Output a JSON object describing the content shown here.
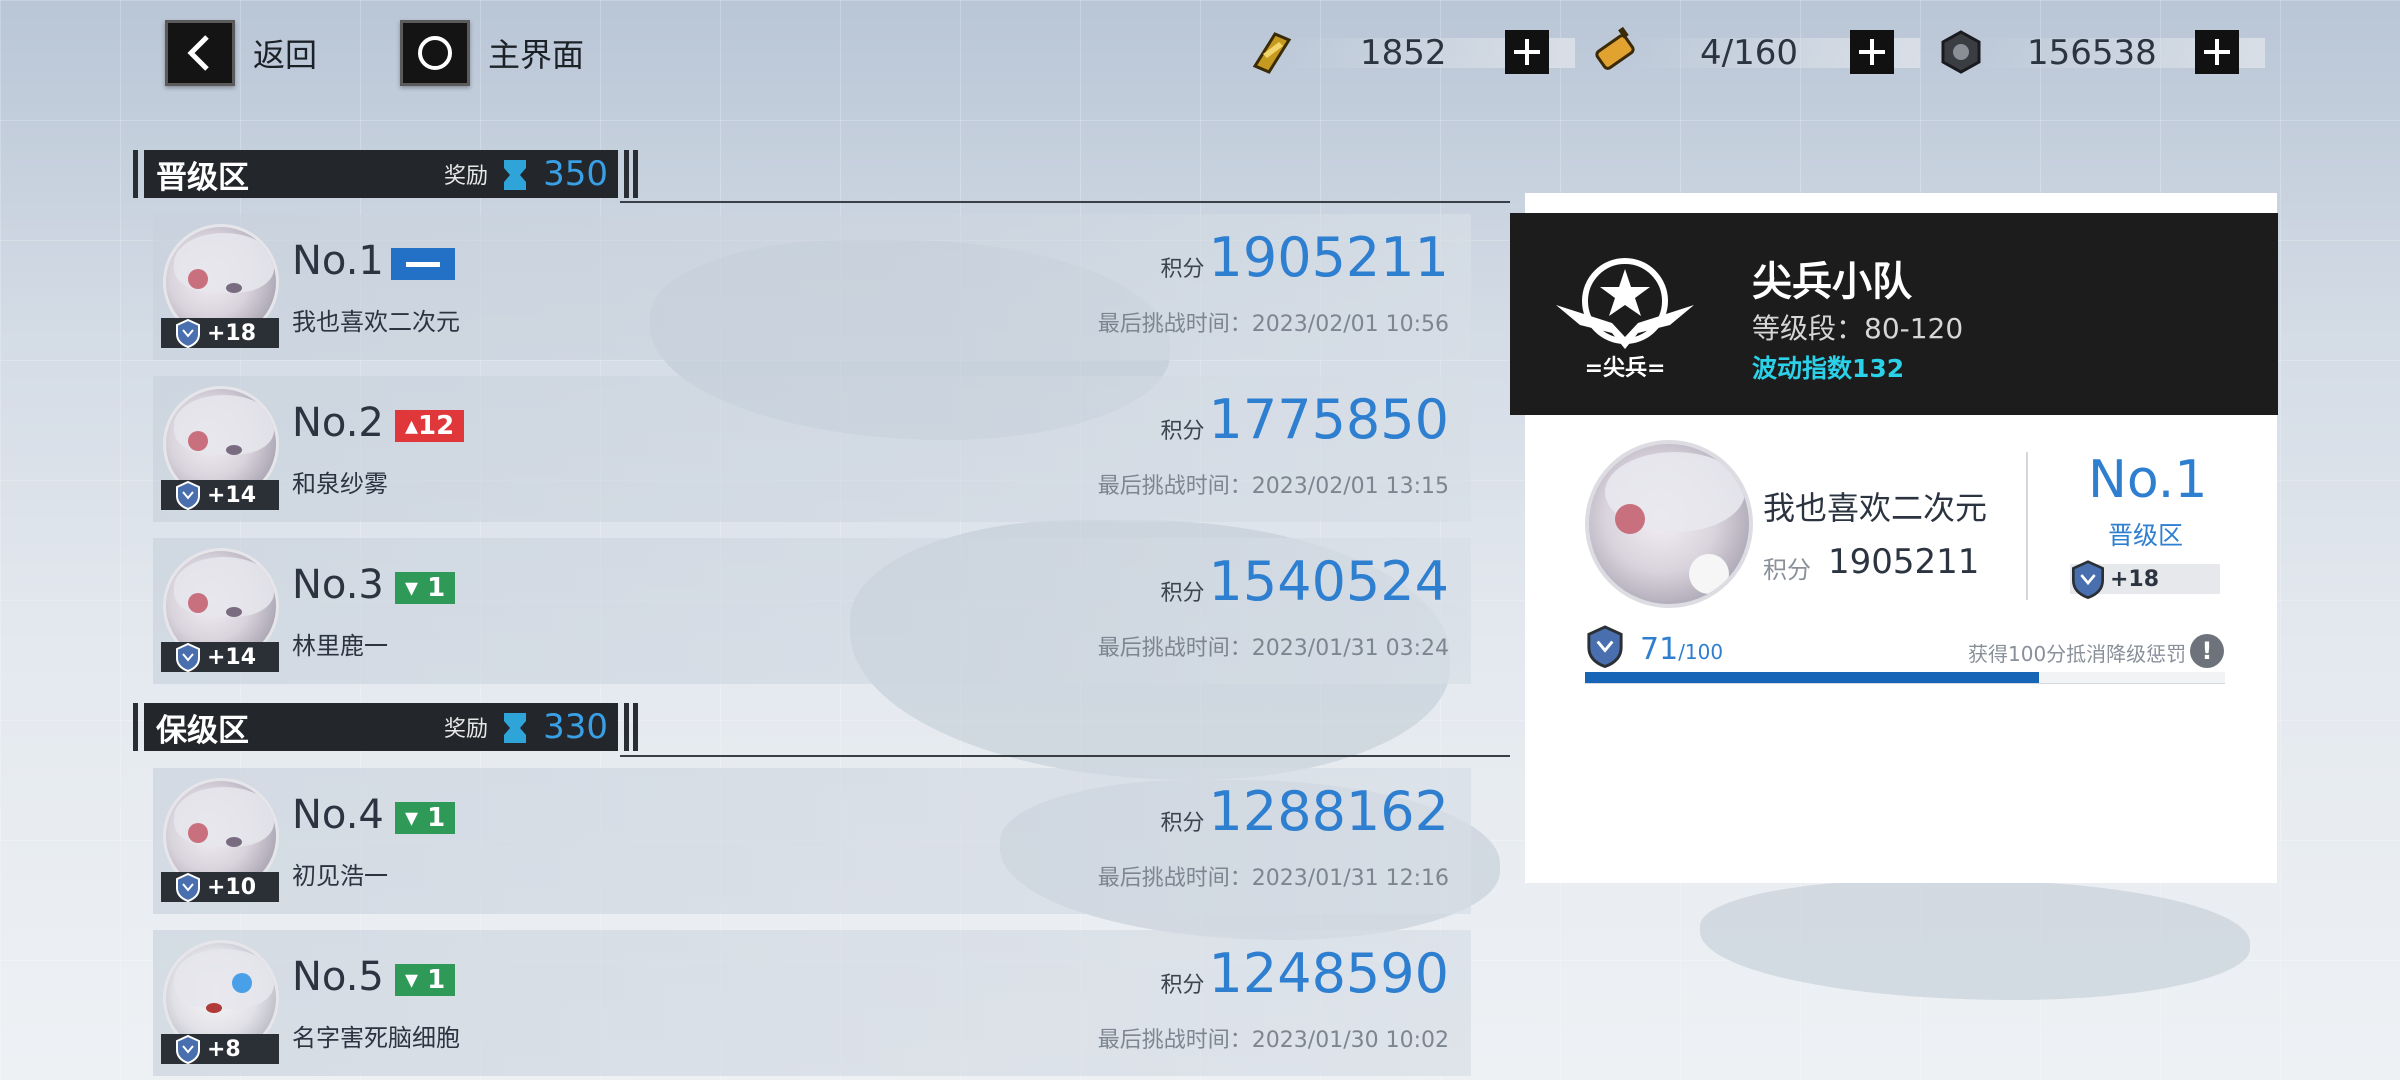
{
  "top": {
    "back_label": "返回",
    "home_label": "主界面",
    "resources": [
      {
        "icon": "gold-bar-icon",
        "value": "1852"
      },
      {
        "icon": "battery-icon",
        "value": "4/160"
      },
      {
        "icon": "gear-nut-icon",
        "value": "156538"
      }
    ]
  },
  "sections": [
    {
      "title": "晋级区",
      "reward_label": "奖励",
      "reward_value": "350"
    },
    {
      "title": "保级区",
      "reward_label": "奖励",
      "reward_value": "330"
    }
  ],
  "rows": [
    {
      "rank": "No.1",
      "change_type": "same",
      "change": "",
      "name": "我也喜欢二次元",
      "level": "+18",
      "score_label": "积分",
      "score": "1905211",
      "time": "最后挑战时间：2023/02/01   10:56"
    },
    {
      "rank": "No.2",
      "change_type": "up",
      "change": "▴12",
      "name": "和泉纱雾",
      "level": "+14",
      "score_label": "积分",
      "score": "1775850",
      "time": "最后挑战时间：2023/02/01   13:15"
    },
    {
      "rank": "No.3",
      "change_type": "down",
      "change": "▾ 1",
      "name": "林里鹿一",
      "level": "+14",
      "score_label": "积分",
      "score": "1540524",
      "time": "最后挑战时间：2023/01/31   03:24"
    },
    {
      "rank": "No.4",
      "change_type": "down",
      "change": "▾ 1",
      "name": "初见浩一",
      "level": "+10",
      "score_label": "积分",
      "score": "1288162",
      "time": "最后挑战时间：2023/01/31   12:16"
    },
    {
      "rank": "No.5",
      "change_type": "down",
      "change": "▾ 1",
      "name": "名字害死脑细胞",
      "level": "+8",
      "score_label": "积分",
      "score": "1248590",
      "time": "最后挑战时间：2023/01/30   10:02"
    }
  ],
  "panel": {
    "emblem_text": "=尖兵=",
    "team_name": "尖兵小队",
    "level_range": "等级段：80-120",
    "wave_index": "波动指数132",
    "me": {
      "name": "我也喜欢二次元",
      "score_label": "积分",
      "score": "1905211",
      "rank": "No.1",
      "zone": "晋级区",
      "level": "+18"
    },
    "progress": {
      "value": "71",
      "max": "/100",
      "fraction": 0.71,
      "hint": "获得100分抵消降级惩罚",
      "info_glyph": "!"
    }
  },
  "colors": {
    "accent_blue": "#2f7fd1",
    "up_red": "#e0373b",
    "down_green": "#2f9a57",
    "same_blue": "#2271c7",
    "wave_cyan": "#2ad1e8"
  }
}
